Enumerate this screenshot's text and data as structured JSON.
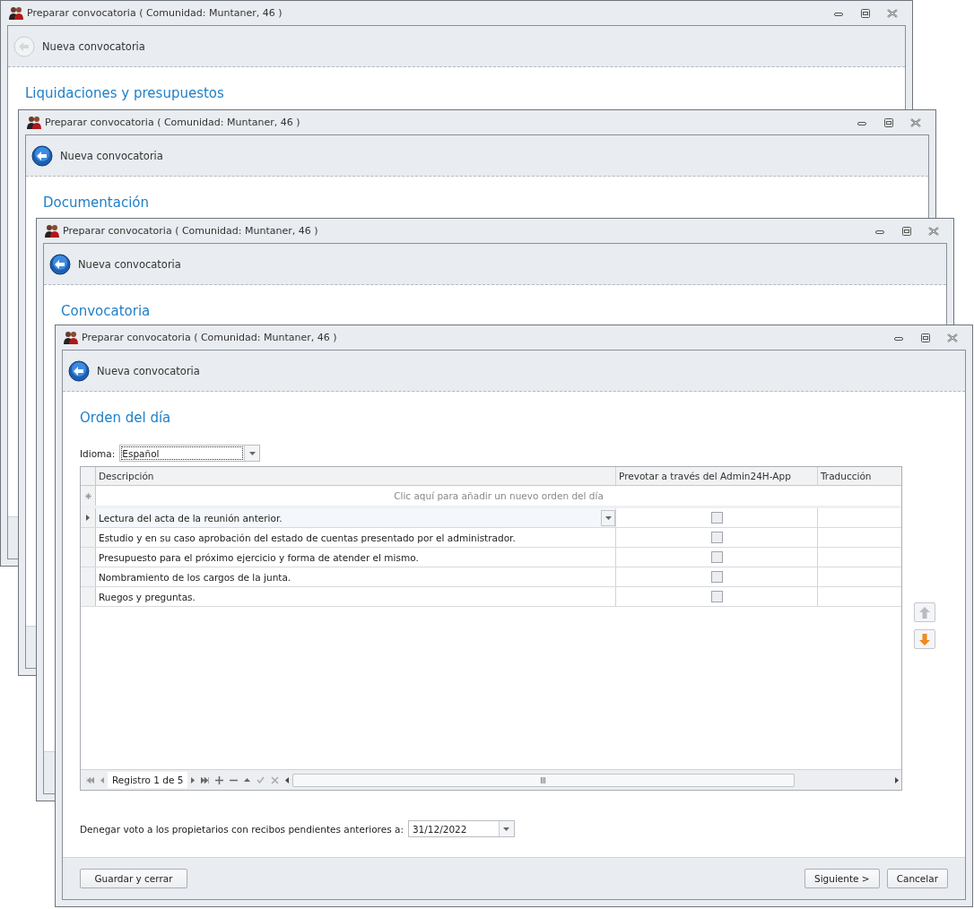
{
  "windows": [
    {
      "title": "Preparar convocatoria ( Comunidad: Muntaner, 46 )",
      "header": "Nueva convocatoria",
      "back_enabled": false,
      "section": "Liquidaciones y presupuestos"
    },
    {
      "title": "Preparar convocatoria ( Comunidad: Muntaner, 46 )",
      "header": "Nueva convocatoria",
      "back_enabled": true,
      "section": "Documentación"
    },
    {
      "title": "Preparar convocatoria ( Comunidad: Muntaner, 46 )",
      "header": "Nueva convocatoria",
      "back_enabled": true,
      "section": "Convocatoria"
    },
    {
      "title": "Preparar convocatoria ( Comunidad: Muntaner, 46 )",
      "header": "Nueva convocatoria",
      "back_enabled": true,
      "section": "Orden del día"
    }
  ],
  "form": {
    "language_label": "Idioma:",
    "language": "Español",
    "columns": [
      "Descripción",
      "Prevotar a través del Admin24H-App",
      "Traducción"
    ],
    "new_row_placeholder": "Clic aquí para añadir un nuevo orden del día",
    "rows": [
      {
        "description": "Lectura del acta de la reunión anterior.",
        "prevote": false,
        "selected": true
      },
      {
        "description": "Estudio y en su caso aprobación del estado de cuentas presentado por el administrador.",
        "prevote": false,
        "selected": false
      },
      {
        "description": "Presupuesto para el próximo ejercicio y forma de atender el mismo.",
        "prevote": false,
        "selected": false
      },
      {
        "description": "Nombramiento de los cargos de la junta.",
        "prevote": false,
        "selected": false
      },
      {
        "description": "Ruegos y preguntas.",
        "prevote": false,
        "selected": false
      }
    ],
    "record_text": "Registro 1 de 5",
    "move_up_enabled": false,
    "move_down_enabled": true,
    "deny_label": "Denegar voto a los propietarios con recibos pendientes anteriores a:",
    "deny_date": "31/12/2022",
    "buttons": [
      {
        "label": "Guardar y cerrar",
        "kind": "left"
      },
      {
        "label": "Siguiente >",
        "kind": "right"
      },
      {
        "label": "Cancelar",
        "kind": "right"
      }
    ]
  }
}
